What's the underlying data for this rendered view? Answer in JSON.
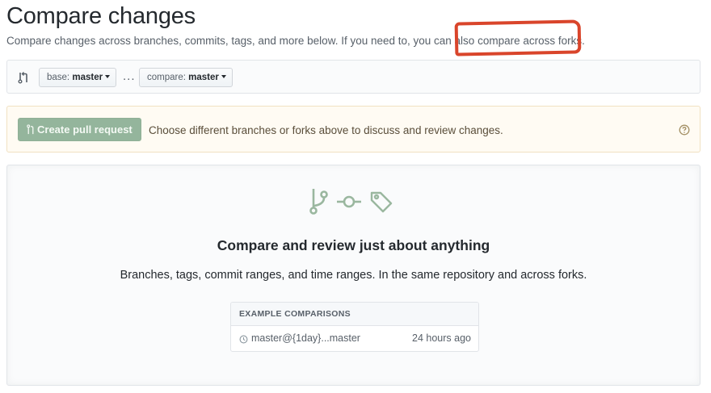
{
  "header": {
    "title": "Compare changes",
    "subtitle_text": "Compare changes across branches, commits, tags, and more below. If you need to, you can also ",
    "subtitle_link": "compare across forks",
    "subtitle_end": "."
  },
  "range_editor": {
    "base_prefix": "base:",
    "base_branch": "master",
    "separator": "...",
    "compare_prefix": "compare:",
    "compare_branch": "master",
    "icon": "git-compare-icon"
  },
  "flash": {
    "button_label": "Create pull request",
    "message": "Choose different branches or forks above to discuss and review changes.",
    "help_icon": "question-icon"
  },
  "blankslate": {
    "icons": [
      "git-branch-icon",
      "git-commit-icon",
      "tag-icon"
    ],
    "title": "Compare and review just about anything",
    "description": "Branches, tags, commit ranges, and time ranges. In the same repository and across forks.",
    "examples_header": "EXAMPLE COMPARISONS",
    "examples": [
      {
        "range": "master@{1day}...master",
        "time": "24 hours ago",
        "icon": "history-icon"
      }
    ]
  },
  "colors": {
    "annotation": "#d9452b",
    "button_disabled_green": "#94b59c",
    "flash_bg": "#fffbf3",
    "octicon_green": "#9ab79f"
  }
}
